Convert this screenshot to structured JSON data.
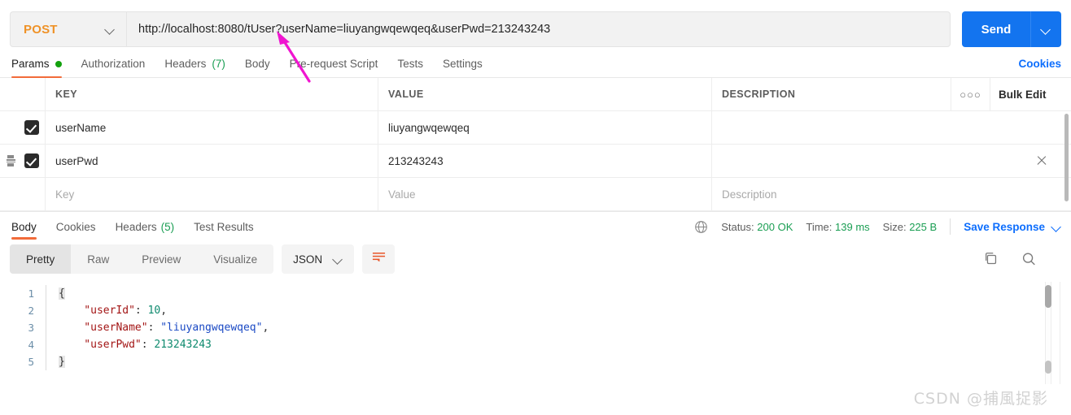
{
  "request": {
    "method": "POST",
    "url": "http://localhost:8080/tUser?userName=liuyangwqewqeq&userPwd=213243243",
    "send_label": "Send",
    "cookies_label": "Cookies",
    "tabs": [
      {
        "label": "Params",
        "badge": "dot"
      },
      {
        "label": "Authorization",
        "badge": ""
      },
      {
        "label": "Headers",
        "badge": "(7)"
      },
      {
        "label": "Body",
        "badge": ""
      },
      {
        "label": "Pre-request Script",
        "badge": ""
      },
      {
        "label": "Tests",
        "badge": ""
      },
      {
        "label": "Settings",
        "badge": ""
      }
    ]
  },
  "params_table": {
    "headers": {
      "key": "KEY",
      "value": "VALUE",
      "description": "DESCRIPTION"
    },
    "bulk_edit_label": "Bulk Edit",
    "dots_label": "○○○",
    "rows": [
      {
        "checked": true,
        "key": "userName",
        "value": "liuyangwqewqeq",
        "description": ""
      },
      {
        "checked": true,
        "key": "userPwd",
        "value": "213243243",
        "description": ""
      }
    ],
    "placeholder_row": {
      "key": "Key",
      "value": "Value",
      "description": "Description"
    }
  },
  "response": {
    "tabs": [
      {
        "label": "Body",
        "badge": ""
      },
      {
        "label": "Cookies",
        "badge": ""
      },
      {
        "label": "Headers",
        "badge": "(5)"
      },
      {
        "label": "Test Results",
        "badge": ""
      }
    ],
    "status_label": "Status:",
    "status_value": "200 OK",
    "time_label": "Time:",
    "time_value": "139 ms",
    "size_label": "Size:",
    "size_value": "225 B",
    "save_response_label": "Save Response",
    "view_modes": [
      "Pretty",
      "Raw",
      "Preview",
      "Visualize"
    ],
    "active_view_mode": "Pretty",
    "format": "JSON",
    "body_lines": [
      {
        "n": "1",
        "tokens": [
          {
            "t": "{",
            "c": "k-pun brace-hl"
          }
        ]
      },
      {
        "n": "2",
        "tokens": [
          {
            "t": "    \"userId\"",
            "c": "k-key"
          },
          {
            "t": ": ",
            "c": "k-pun"
          },
          {
            "t": "10",
            "c": "k-num"
          },
          {
            "t": ",",
            "c": "k-pun"
          }
        ]
      },
      {
        "n": "3",
        "tokens": [
          {
            "t": "    \"userName\"",
            "c": "k-key"
          },
          {
            "t": ": ",
            "c": "k-pun"
          },
          {
            "t": "\"liuyangwqewqeq\"",
            "c": "k-str"
          },
          {
            "t": ",",
            "c": "k-pun"
          }
        ]
      },
      {
        "n": "4",
        "tokens": [
          {
            "t": "    \"userPwd\"",
            "c": "k-key"
          },
          {
            "t": ": ",
            "c": "k-pun"
          },
          {
            "t": "213243243",
            "c": "k-num"
          }
        ]
      },
      {
        "n": "5",
        "tokens": [
          {
            "t": "}",
            "c": "k-pun brace-hl"
          }
        ]
      }
    ]
  },
  "watermark": "CSDN @捕風捉影",
  "colors": {
    "method_orange": "#ef9227",
    "send_blue": "#1374ef",
    "link_blue": "#0d6efd",
    "tab_underline": "#f26b3a",
    "status_green": "#1a9e53",
    "dot_green": "#13a10e",
    "annotation_arrow": "#f015d0"
  }
}
